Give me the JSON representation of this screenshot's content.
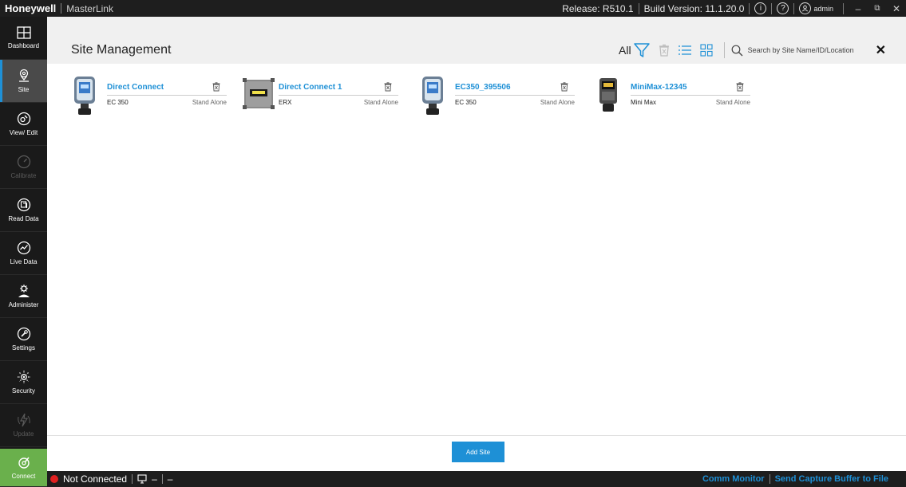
{
  "titlebar": {
    "brand": "Honeywell",
    "app_name": "MasterLink",
    "release": "Release: R510.1",
    "build": "Build Version: 11.1.20.0",
    "info_glyph": "i",
    "help_glyph": "?",
    "user": "admin",
    "minimize": "–",
    "restore": "⧉",
    "close": "✕"
  },
  "sidebar": {
    "items": [
      {
        "label": "Dashboard",
        "icon": "dashboard-icon",
        "state": "normal"
      },
      {
        "label": "Site",
        "icon": "site-icon",
        "state": "active"
      },
      {
        "label": "View/ Edit",
        "icon": "view-edit-icon",
        "state": "normal"
      },
      {
        "label": "Calibrate",
        "icon": "calibrate-icon",
        "state": "disabled"
      },
      {
        "label": "Read Data",
        "icon": "read-data-icon",
        "state": "normal"
      },
      {
        "label": "Live Data",
        "icon": "live-data-icon",
        "state": "normal"
      },
      {
        "label": "Administer",
        "icon": "administer-icon",
        "state": "normal"
      },
      {
        "label": "Settings",
        "icon": "settings-icon",
        "state": "normal"
      },
      {
        "label": "Security",
        "icon": "security-icon",
        "state": "normal"
      },
      {
        "label": "Update",
        "icon": "update-icon",
        "state": "disabled"
      }
    ],
    "connect": {
      "label": "Connect",
      "icon": "connect-icon"
    }
  },
  "header": {
    "title": "Site Management",
    "filter_label": "All",
    "search_placeholder": "Search by Site Name/ID/Location",
    "clear": "✕"
  },
  "sites": [
    {
      "name": "Direct Connect",
      "model": "EC 350",
      "mode": "Stand Alone",
      "device": "ec350"
    },
    {
      "name": "Direct Connect 1",
      "model": "ERX",
      "mode": "Stand Alone",
      "device": "erx"
    },
    {
      "name": "EC350_395506",
      "model": "EC 350",
      "mode": "Stand Alone",
      "device": "ec350"
    },
    {
      "name": "MiniMax-12345",
      "model": "Mini Max",
      "mode": "Stand Alone",
      "device": "minimax"
    }
  ],
  "actions": {
    "add_site": "Add Site"
  },
  "statusbar": {
    "connection": "Not Connected",
    "dash1": "–",
    "dash2": "–",
    "comm_monitor": "Comm Monitor",
    "send_capture": "Send Capture Buffer to File"
  },
  "colors": {
    "accent": "#1e90d6",
    "connect_green": "#6ab04c",
    "status_red": "#e02020",
    "titlebar": "#1e1e1e",
    "sidebar": "#1a1a1a"
  }
}
